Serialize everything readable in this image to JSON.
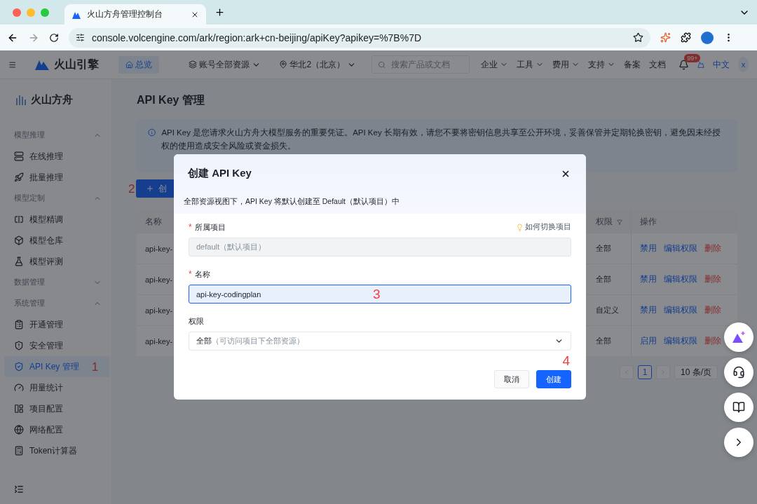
{
  "browser": {
    "tab_title": "火山方舟管理控制台",
    "url": "console.volcengine.com/ark/region:ark+cn-beijing/apiKey?apikey=%7B%7D"
  },
  "topnav": {
    "logo": "火山引擎",
    "overview": "总览",
    "scope": "账号全部资源",
    "region": "华北2（北京）",
    "search": {
      "placeholder": "搜索产品或文档"
    },
    "menus": [
      {
        "label": "企业",
        "dropdown": true
      },
      {
        "label": "工具",
        "dropdown": true
      },
      {
        "label": "费用",
        "dropdown": true
      },
      {
        "label": "支持",
        "dropdown": true
      },
      {
        "label": "备案",
        "dropdown": false
      },
      {
        "label": "文档",
        "dropdown": false
      }
    ],
    "notification_badge": "99+",
    "language": "中文",
    "avatar": "x"
  },
  "sidebar": {
    "title": "火山方舟",
    "groups": [
      {
        "label": "模型推理",
        "expanded": true,
        "items": [
          {
            "label": "在线推理",
            "selected": false
          },
          {
            "label": "批量推理",
            "selected": false
          }
        ]
      },
      {
        "label": "模型定制",
        "expanded": true,
        "items": [
          {
            "label": "模型精调",
            "selected": false
          },
          {
            "label": "模型仓库",
            "selected": false
          },
          {
            "label": "模型评测",
            "selected": false
          }
        ]
      },
      {
        "label": "数据管理",
        "expanded": false
      },
      {
        "label": "系统管理",
        "expanded": true,
        "items": [
          {
            "label": "开通管理",
            "selected": false
          },
          {
            "label": "安全管理",
            "selected": false
          },
          {
            "label": "API Key 管理",
            "selected": true,
            "annotation": "1"
          },
          {
            "label": "用量统计",
            "selected": false
          },
          {
            "label": "项目配置",
            "selected": false
          },
          {
            "label": "网络配置",
            "selected": false
          },
          {
            "label": "Token计算器",
            "selected": false
          }
        ]
      }
    ]
  },
  "page": {
    "title": "API Key 管理",
    "notice": [
      "API Key 是您请求火山方舟大模型服务的重要凭证。API Key 长期有效，请您不要将密钥信息共享至公开环境，妥善保管并定期轮换密钥，避免因未经授权的使用造成安全风险或资金损失。"
    ],
    "create_button": {
      "label": "创",
      "annotation": "2"
    },
    "table": {
      "columns": [
        "名称",
        "权限",
        "操作"
      ],
      "rows": [
        {
          "name": "api-key-",
          "permission": "全部",
          "actions": [
            {
              "label": "禁用",
              "kind": "link"
            },
            {
              "label": "编辑权限",
              "kind": "link"
            },
            {
              "label": "删除",
              "kind": "danger"
            }
          ]
        },
        {
          "name": "api-key-",
          "permission": "全部",
          "actions": [
            {
              "label": "禁用",
              "kind": "link"
            },
            {
              "label": "编辑权限",
              "kind": "link"
            },
            {
              "label": "删除",
              "kind": "danger"
            }
          ]
        },
        {
          "name": "api-key-",
          "permission": "自定义",
          "actions": [
            {
              "label": "禁用",
              "kind": "link"
            },
            {
              "label": "编辑权限",
              "kind": "link"
            },
            {
              "label": "删除",
              "kind": "danger"
            }
          ]
        },
        {
          "name": "api-key-",
          "permission": "全部",
          "actions": [
            {
              "label": "启用",
              "kind": "link"
            },
            {
              "label": "编辑权限",
              "kind": "link"
            },
            {
              "label": "删除",
              "kind": "danger"
            }
          ]
        }
      ]
    },
    "pagination": {
      "current_page": "1",
      "page_size": "10 条/页"
    }
  },
  "modal": {
    "title": "创建 API Key",
    "notice": "全部资源视图下，API Key 将默认创建至 Default（默认项目）中",
    "fields": [
      {
        "kind": "input",
        "label": "所属项目",
        "required_mark": "*",
        "value": "default（默认项目）",
        "disabled": true,
        "help": "如何切换项目"
      },
      {
        "kind": "input",
        "label": "名称",
        "required_mark": "*",
        "value": "api-key-codingplan",
        "disabled": false,
        "focused": true,
        "annotation": "3"
      },
      {
        "kind": "select",
        "label": "权限",
        "value": "全部",
        "hint": "（可访问项目下全部资源）"
      }
    ],
    "buttons": [
      {
        "label": "取消",
        "kind": "secondary"
      },
      {
        "label": "创建",
        "kind": "primary",
        "annotation": "4"
      }
    ]
  }
}
